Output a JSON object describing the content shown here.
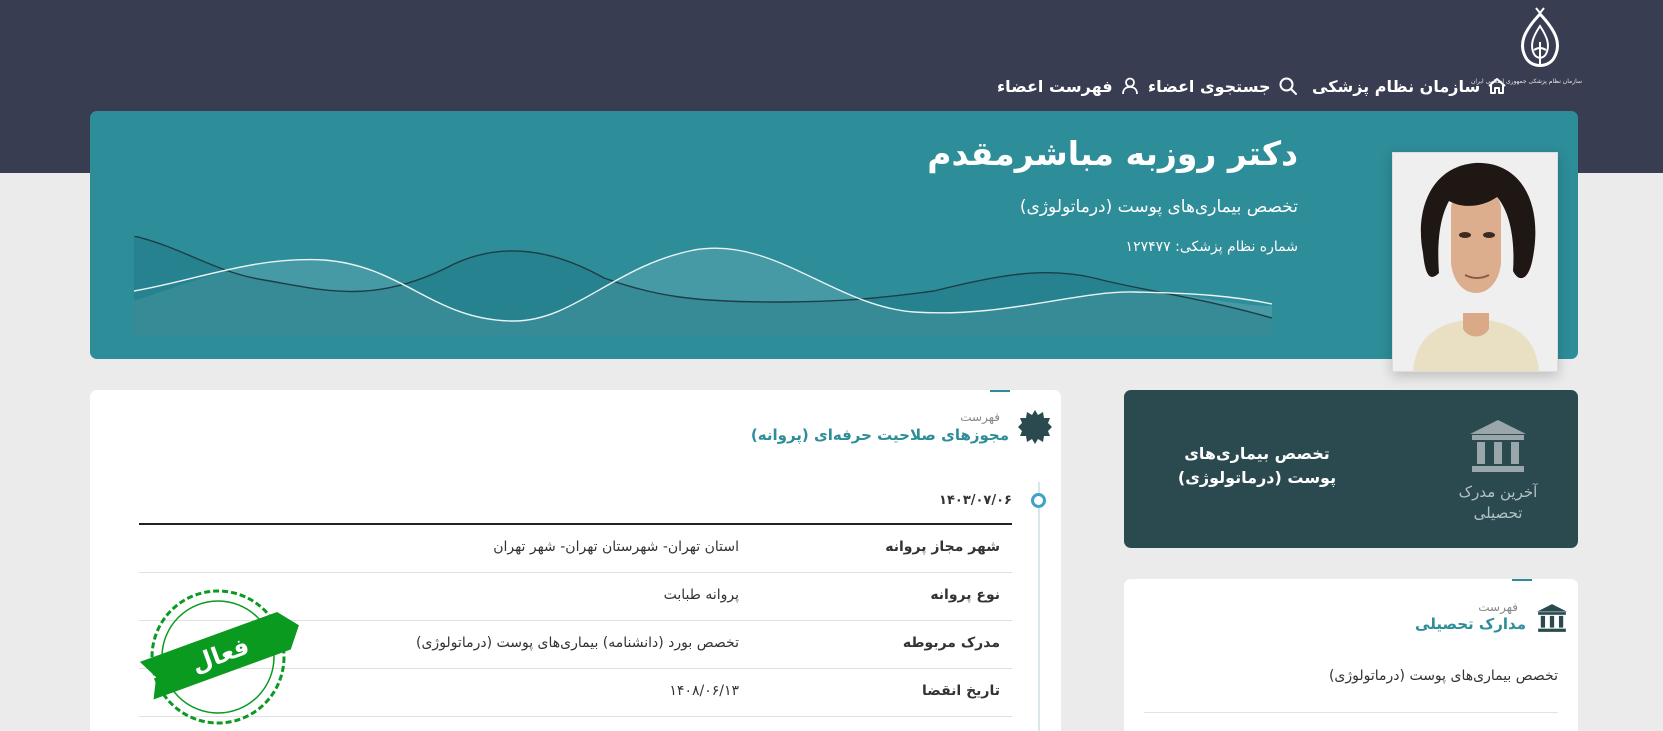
{
  "header": {
    "logo_text": "سازمان نظام پزشکی جمهوری اسلامی ایران",
    "nav": [
      {
        "label": "سازمان نظام پزشکی",
        "icon": "home-icon"
      },
      {
        "label": "جستجوی اعضاء",
        "icon": "search-icon"
      },
      {
        "label": "فهرست اعضاء",
        "icon": "user-icon"
      }
    ]
  },
  "profile": {
    "name": "دکتر روزبه مباشرمقدم",
    "specialty": "تخصص بیماری‌های پوست (درماتولوژی)",
    "medical_number": "شماره نظام پزشکی: ۱۲۷۴۷۷"
  },
  "latest_degree": {
    "title": "تخصص بیماری‌های پوست (درماتولوژی)",
    "label": "آخرین مدرک تحصیلی",
    "icon": "bank-icon"
  },
  "education": {
    "small": "فهرست",
    "title": "مدارک تحصیلی",
    "items": [
      "تخصص بیماری‌های پوست (درماتولوژی)"
    ]
  },
  "licenses": {
    "small": "فهرست",
    "title": "مجوزهای صلاحیت حرفه‌ای (پروانه)",
    "date": "۱۴۰۳/۰۷/۰۶",
    "rows": [
      {
        "key": "شهر مجاز پروانه",
        "value": "استان تهران- شهرستان تهران- شهر تهران"
      },
      {
        "key": "نوع پروانه",
        "value": "پروانه طبابت"
      },
      {
        "key": "مدرک مربوطه",
        "value": "تخصص بورد (دانشنامه) بیماری‌های پوست (درماتولوژی)"
      },
      {
        "key": "تاریخ انقضا",
        "value": "۱۴۰۸/۰۶/۱۳"
      }
    ],
    "stamp": "فعال"
  },
  "colors": {
    "topbar": "#383d52",
    "hero": "#2d8d99",
    "dark_card": "#2b4a50",
    "stamp_green": "#0a9a1f"
  }
}
